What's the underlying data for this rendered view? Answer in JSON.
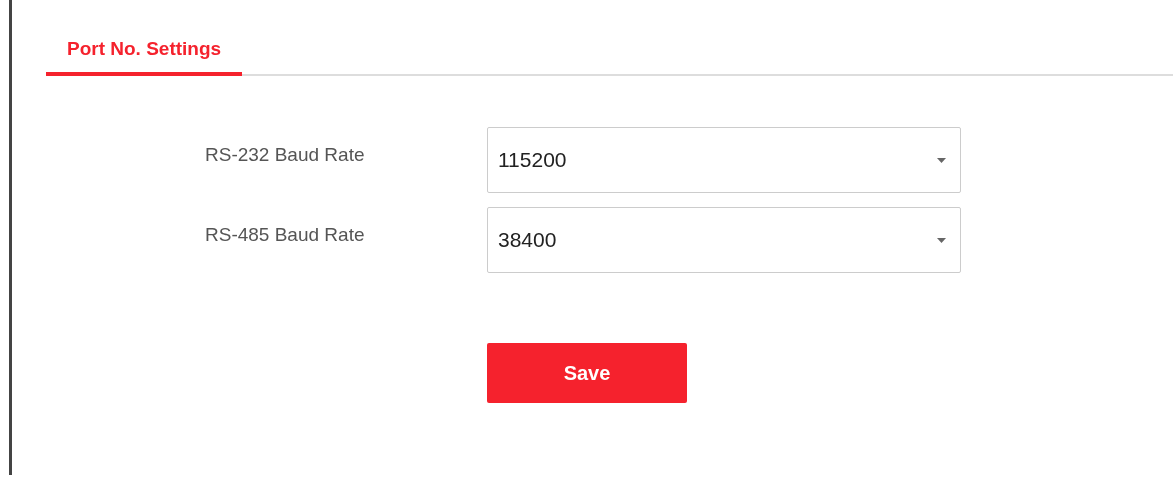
{
  "tabs": [
    {
      "label": "Port No. Settings",
      "selected": true
    }
  ],
  "fields": [
    {
      "label": "RS-232 Baud Rate",
      "value": "115200"
    },
    {
      "label": "RS-485 Baud Rate",
      "value": "38400"
    }
  ],
  "buttons": [
    "Save"
  ]
}
